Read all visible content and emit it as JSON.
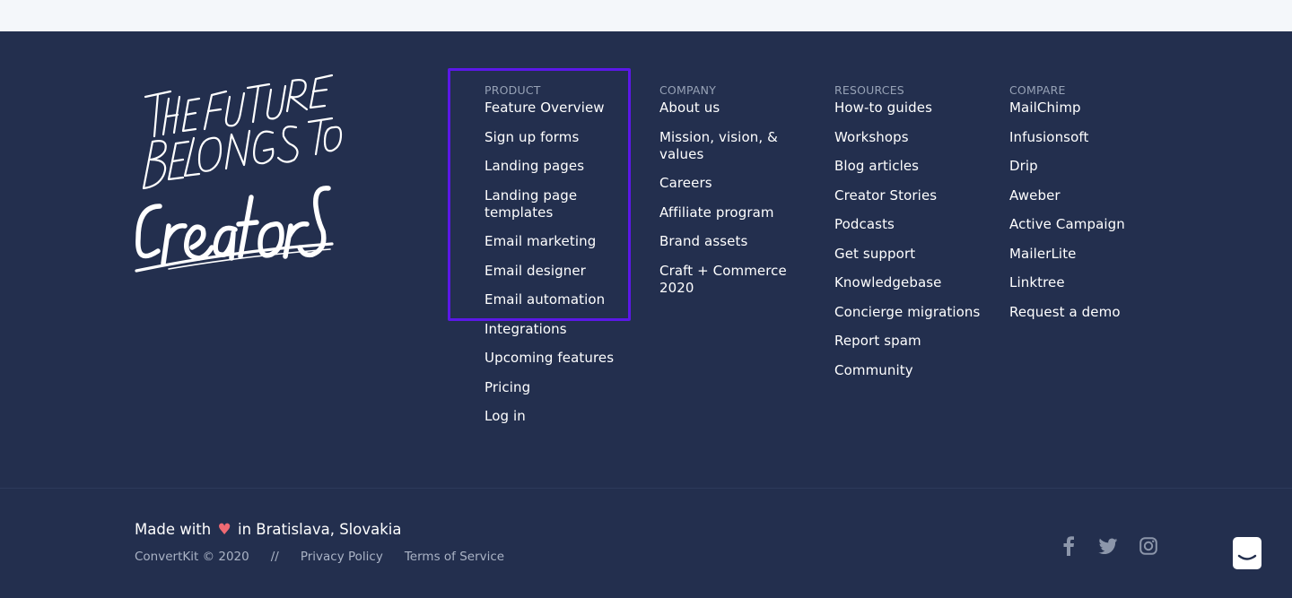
{
  "logo": {
    "text": "THE FUTURE BELONGS TO creators"
  },
  "columns": [
    {
      "heading": "PRODUCT",
      "items": [
        "Feature Overview",
        "Sign up forms",
        "Landing pages",
        "Landing page templates",
        "Email marketing",
        "Email designer",
        "Email automation",
        "Integrations",
        "Upcoming features",
        "Pricing",
        "Log in"
      ]
    },
    {
      "heading": "COMPANY",
      "items": [
        "About us",
        "Mission, vision, & values",
        "Careers",
        "Affiliate program",
        "Brand assets",
        "Craft + Commerce 2020"
      ]
    },
    {
      "heading": "RESOURCES",
      "items": [
        "How-to guides",
        "Workshops",
        "Blog articles",
        "Creator Stories",
        "Podcasts",
        "Get support",
        "Knowledgebase",
        "Concierge migrations",
        "Report spam",
        "Community"
      ]
    },
    {
      "heading": "COMPARE",
      "items": [
        "MailChimp",
        "Infusionsoft",
        "Drip",
        "Aweber",
        "Active Campaign",
        "MailerLite",
        "Linktree",
        "Request a demo"
      ]
    }
  ],
  "bottom": {
    "made_with_prefix": "Made with",
    "made_with_suffix": "in Bratislava, Slovakia",
    "copyright": "ConvertKit © 2020",
    "separator": "//",
    "privacy": "Privacy Policy",
    "terms": "Terms of Service"
  },
  "social": [
    "facebook-icon",
    "twitter-icon",
    "instagram-icon"
  ],
  "colors": {
    "footer_bg": "#232f4e",
    "highlight": "#5b18e8",
    "heart": "#ef6a73"
  }
}
